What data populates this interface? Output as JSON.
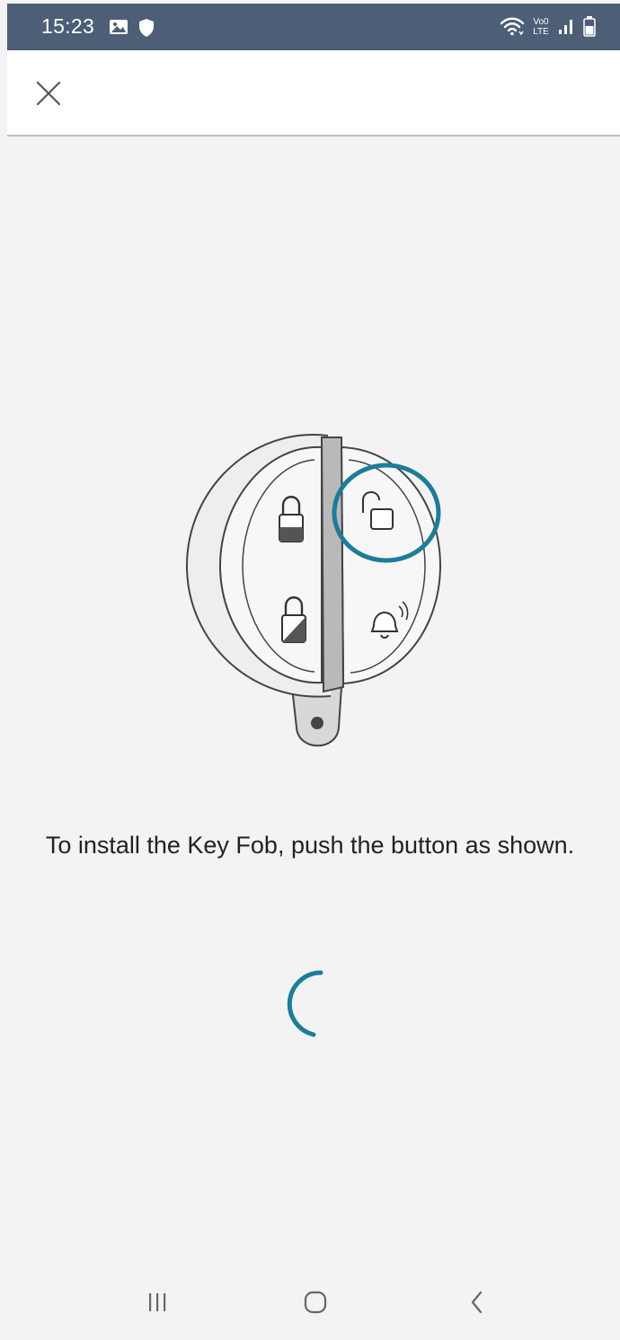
{
  "status_bar": {
    "time": "15:23",
    "left_icons": [
      "gallery-icon",
      "shield-icon"
    ],
    "right_icons": [
      "wifi-icon",
      "volte-icon",
      "signal-icon",
      "battery-icon"
    ],
    "volte_top": "Vo0",
    "volte_bottom": "LTE"
  },
  "header": {
    "close_icon": "close-icon"
  },
  "illustration": {
    "subject": "key-fob",
    "highlight_color": "#1a7d9a"
  },
  "instruction": {
    "text": "To install the Key Fob, push the button as shown."
  },
  "spinner": {
    "color": "#1a7d9a"
  },
  "nav_bar": {
    "recents_icon": "recents-icon",
    "home_icon": "home-icon",
    "back_icon": "back-icon"
  },
  "colors": {
    "status_bar_bg": "#4d5e77",
    "background": "#f3f3f3",
    "accent": "#1a7d9a"
  }
}
